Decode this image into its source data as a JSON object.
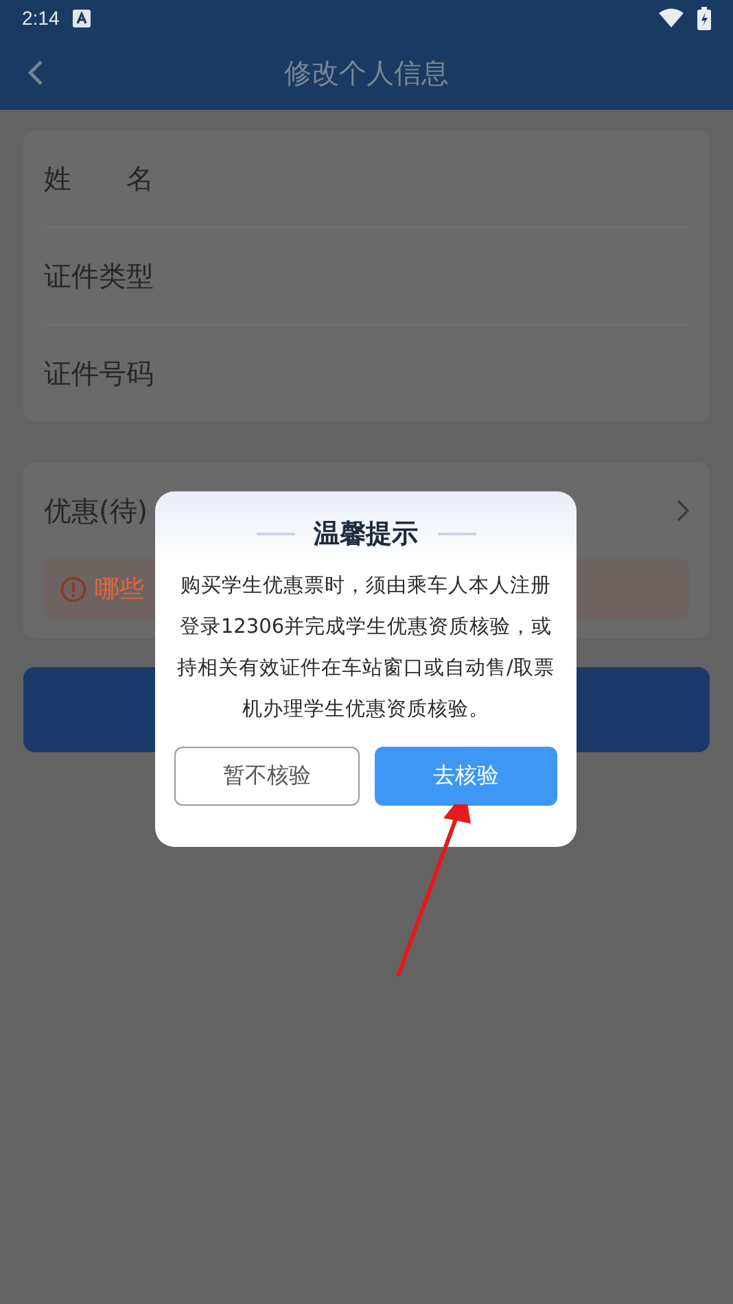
{
  "status_bar": {
    "time": "2:14"
  },
  "header": {
    "title": "修改个人信息"
  },
  "info_rows": [
    {
      "label": "姓　　名"
    },
    {
      "label": "证件类型"
    },
    {
      "label": "证件号码"
    }
  ],
  "discount": {
    "label": "优惠(待)",
    "notice": "哪些"
  },
  "dialog": {
    "title": "温馨提示",
    "message": "购买学生优惠票时，须由乘车人本人注册登录12306并完成学生优惠资质核验，或持相关有效证件在车站窗口或自动售/取票机办理学生优惠资质核验。",
    "buttons": [
      {
        "label": "暂不核验",
        "kind": "secondary"
      },
      {
        "label": "去核验",
        "kind": "primary"
      }
    ]
  }
}
